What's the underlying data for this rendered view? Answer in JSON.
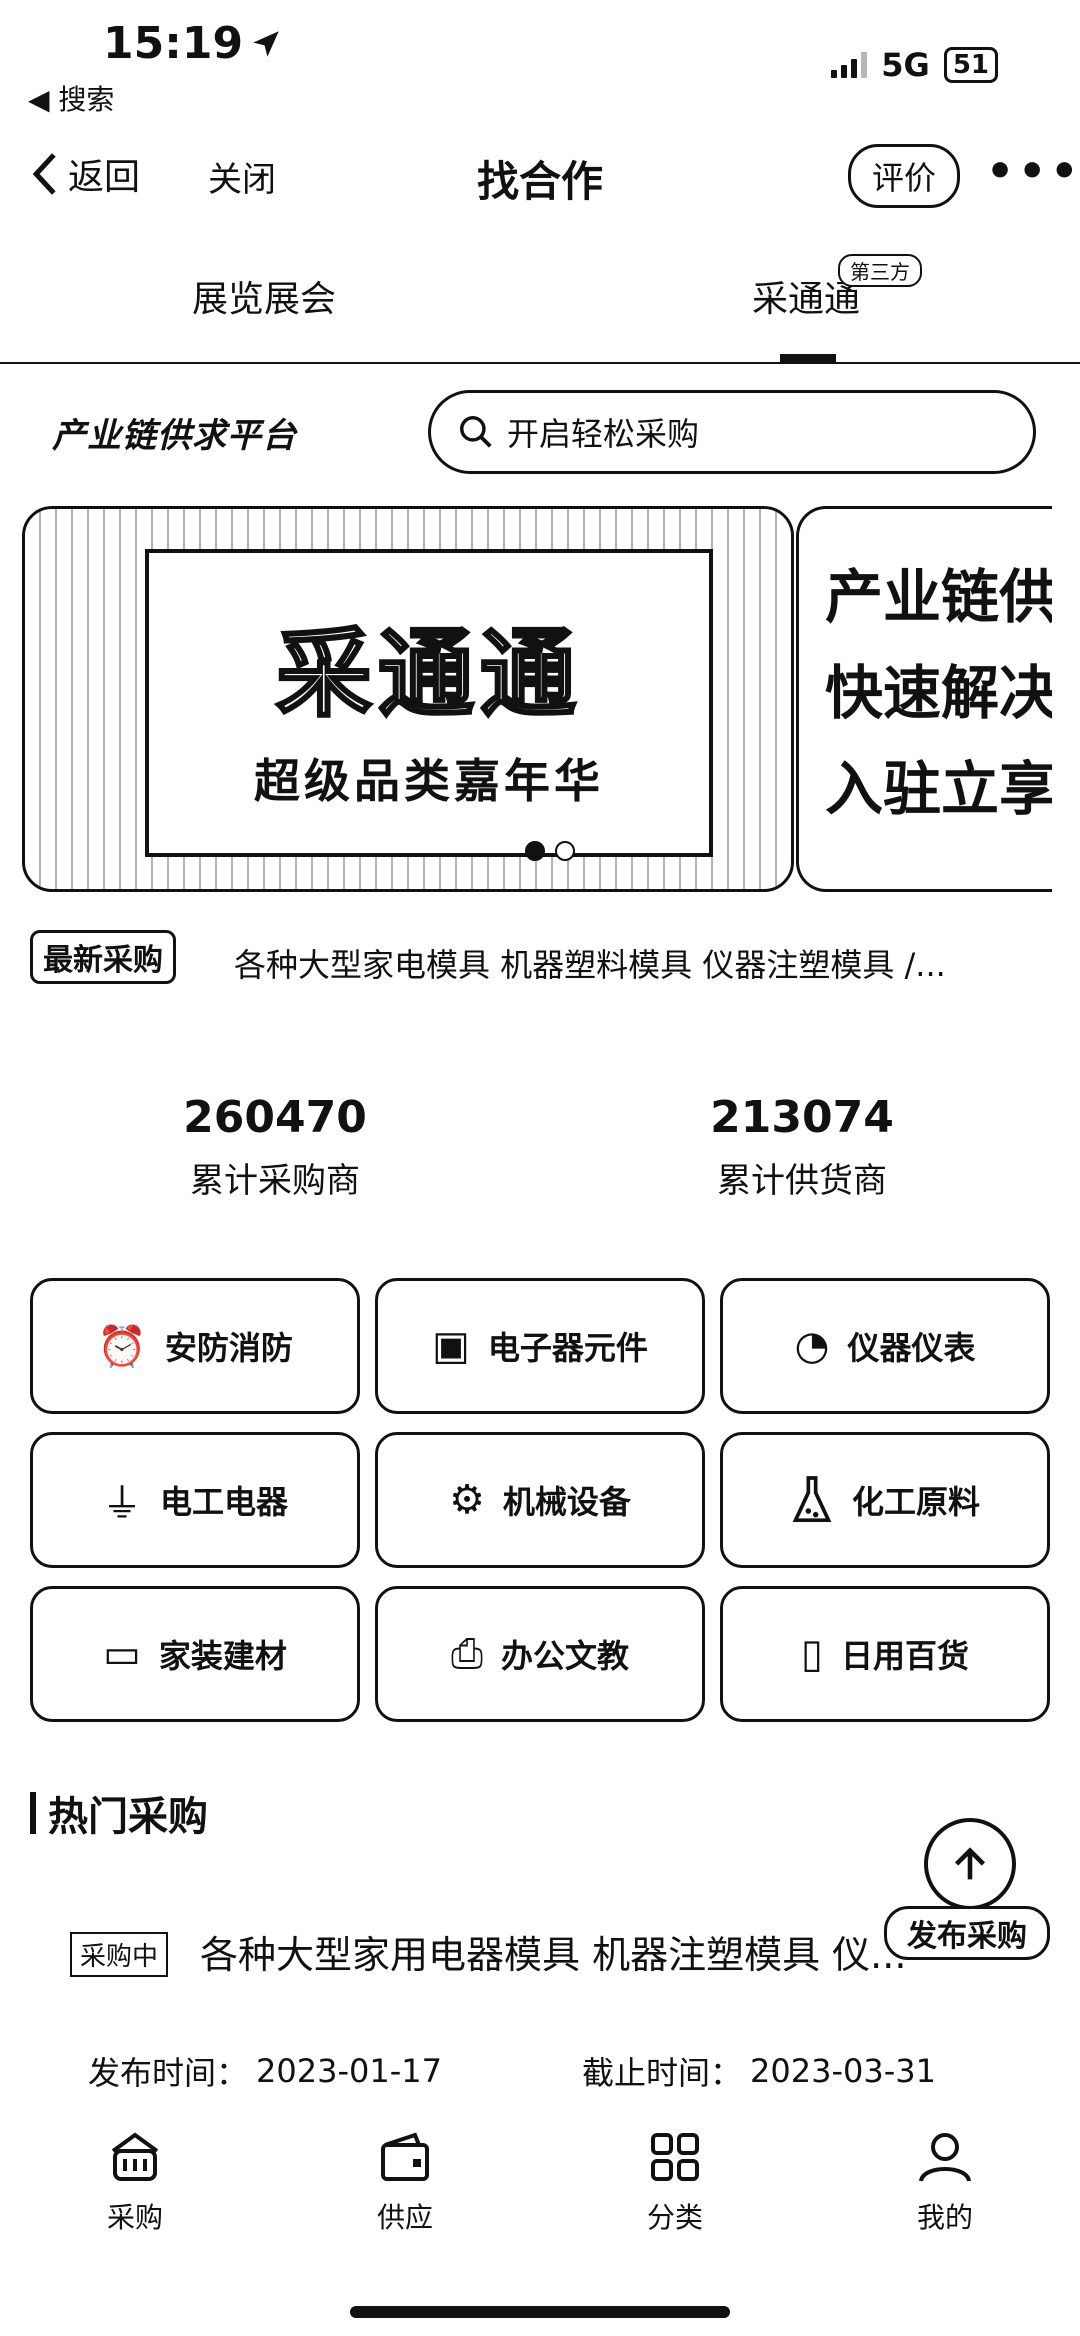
{
  "status_bar": {
    "time": "15:19",
    "back_app": "◀ 搜索",
    "network": "5G",
    "battery": "51"
  },
  "nav": {
    "back_label": "返回",
    "close_label": "关闭",
    "title": "找合作",
    "rate_label": "评价",
    "more_label": "•••"
  },
  "tabs": [
    {
      "label": "展览展会",
      "selected": false
    },
    {
      "label": "采通通",
      "badge": "第三方",
      "selected": true
    }
  ],
  "platform_logo": "产业链供求平台",
  "search": {
    "placeholder": "开启轻松采购"
  },
  "banner": {
    "title": "采通通",
    "subtitle": "超级品类嘉年华",
    "side_lines": [
      "产业链供",
      "快速解决",
      "入驻立享"
    ]
  },
  "ticker": {
    "badge": "最新采购",
    "text": "各种大型家电模具 机器塑料模具 仪器注塑模具 /..."
  },
  "stats": [
    {
      "value": "260470",
      "label": "累计采购商"
    },
    {
      "value": "213074",
      "label": "累计供货商"
    }
  ],
  "categories": [
    {
      "label": "安防消防",
      "icon": "alarm-icon"
    },
    {
      "label": "电子器元件",
      "icon": "chip-icon"
    },
    {
      "label": "仪器仪表",
      "icon": "meter-icon"
    },
    {
      "label": "电工电器",
      "icon": "plug-icon"
    },
    {
      "label": "机械设备",
      "icon": "robot-arm-icon"
    },
    {
      "label": "化工原料",
      "icon": "flask-icon"
    },
    {
      "label": "家装建材",
      "icon": "paint-roller-icon"
    },
    {
      "label": "办公文教",
      "icon": "printer-icon"
    },
    {
      "label": "日用百货",
      "icon": "cup-icon"
    }
  ],
  "hot": {
    "title": "热门采购",
    "item": {
      "status": "采购中",
      "title": "各种大型家用电器模具 机器注塑模具 仪...",
      "publish_label": "发布时间：",
      "publish_date": "2023-01-17",
      "deadline_label": "截止时间：",
      "deadline_date": "2023-03-31"
    }
  },
  "fab": {
    "label": "发布采购"
  },
  "bottom_nav": [
    {
      "label": "采购",
      "icon": "basket-icon"
    },
    {
      "label": "供应",
      "icon": "wallet-icon"
    },
    {
      "label": "分类",
      "icon": "grid-icon"
    },
    {
      "label": "我的",
      "icon": "user-icon"
    }
  ]
}
